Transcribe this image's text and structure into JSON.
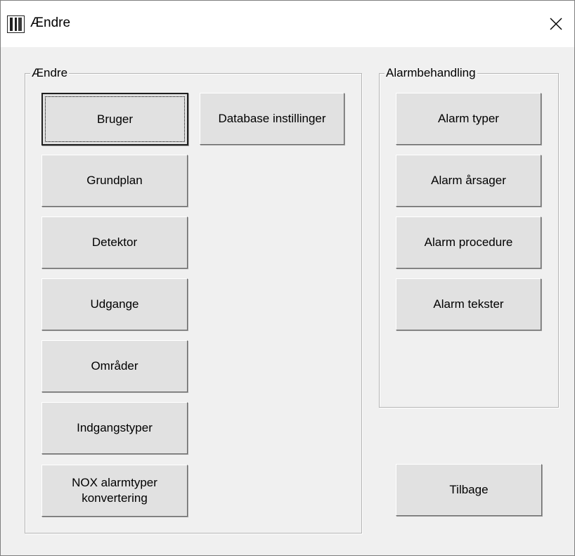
{
  "window": {
    "title": "Ændre",
    "close_symbol": "✕"
  },
  "groups": {
    "left": {
      "label": "Ændre",
      "buttons": [
        {
          "label": "Bruger"
        },
        {
          "label": "Database instillinger"
        },
        {
          "label": "Grundplan"
        },
        {
          "label": "Detektor"
        },
        {
          "label": "Udgange"
        },
        {
          "label": "Områder"
        },
        {
          "label": "Indgangstyper"
        },
        {
          "label": "NOX alarmtyper konvertering",
          "line1": "NOX alarmtyper",
          "line2": "konvertering"
        }
      ]
    },
    "right": {
      "label": "Alarmbehandling",
      "buttons": [
        {
          "label": "Alarm typer"
        },
        {
          "label": "Alarm årsager"
        },
        {
          "label": "Alarm procedure"
        },
        {
          "label": "Alarm tekster"
        }
      ]
    }
  },
  "footer": {
    "back_label": "Tilbage"
  },
  "focused_button": "Bruger",
  "icons": {
    "app": "app-logo-icon",
    "close": "close-icon"
  },
  "colors": {
    "dialog_bg": "#f0f0f0",
    "titlebar_bg": "#ffffff",
    "button_face": "#e1e1e1",
    "group_border": "#b5b5b5"
  }
}
